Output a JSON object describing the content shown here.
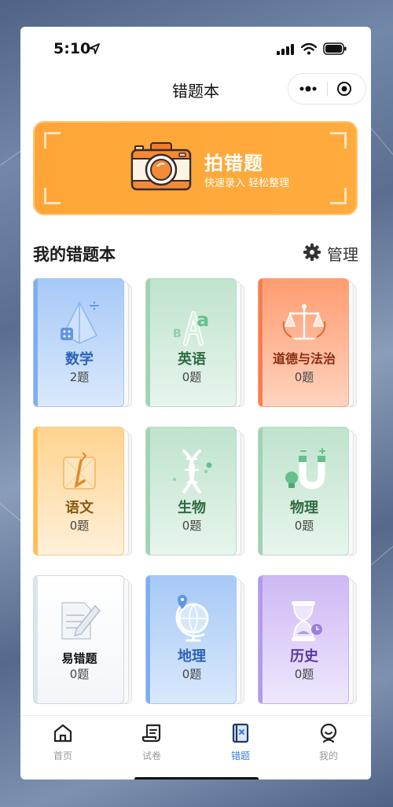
{
  "status_bar": {
    "time": "5:10"
  },
  "nav": {
    "title": "错题本"
  },
  "banner": {
    "title": "拍错题",
    "subtitle": "快速录入 轻松整理"
  },
  "section": {
    "title": "我的错题本",
    "manage_label": "管理"
  },
  "cards": [
    {
      "name": "数学",
      "count": "2题",
      "icon": "pyramid-calculator-icon"
    },
    {
      "name": "英语",
      "count": "0题",
      "icon": "abc-letters-icon"
    },
    {
      "name": "道德与法治",
      "count": "0题",
      "icon": "scales-icon"
    },
    {
      "name": "语文",
      "count": "0题",
      "icon": "book-pen-icon"
    },
    {
      "name": "生物",
      "count": "0题",
      "icon": "dna-icon"
    },
    {
      "name": "物理",
      "count": "0题",
      "icon": "magnet-bulb-icon"
    },
    {
      "name": "易错题",
      "count": "0题",
      "icon": "paper-pencil-icon"
    },
    {
      "name": "地理",
      "count": "0题",
      "icon": "globe-icon"
    },
    {
      "name": "历史",
      "count": "0题",
      "icon": "hourglass-icon"
    }
  ],
  "tabbar": [
    {
      "label": "首页",
      "icon": "home-icon",
      "active": false
    },
    {
      "label": "试卷",
      "icon": "scroll-icon",
      "active": false
    },
    {
      "label": "错题",
      "icon": "notebook-icon",
      "active": true
    },
    {
      "label": "我的",
      "icon": "profile-icon",
      "active": false
    }
  ],
  "colors": {
    "accent": "#3a7be0",
    "banner": "#ffa537",
    "inactive_tab": "#999999"
  }
}
